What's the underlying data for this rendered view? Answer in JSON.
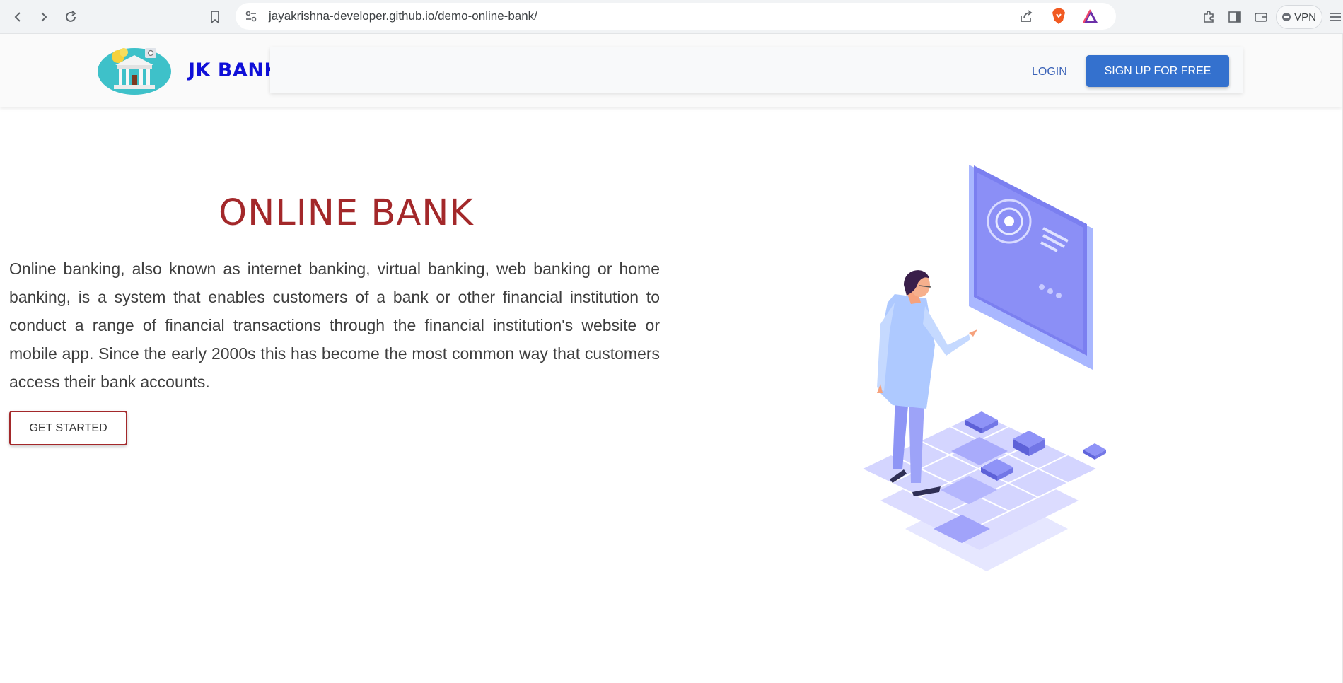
{
  "browser": {
    "url": "jayakrishna-developer.github.io/demo-online-bank/",
    "vpn_label": "VPN",
    "icons": [
      "back-icon",
      "forward-icon",
      "reload-icon",
      "bookmark-icon",
      "site-settings-icon",
      "share-icon",
      "brave-shield-icon",
      "brave-rewards-icon",
      "extensions-icon",
      "sidebar-icon",
      "wallet-icon",
      "menu-icon"
    ]
  },
  "header": {
    "brand": "JK BANK",
    "login_label": "LOGIN",
    "signup_label": "SIGN UP FOR FREE"
  },
  "hero": {
    "title": "ONLINE BANK",
    "description": "Online banking, also known as internet banking, virtual banking, web banking or home banking, is a system that enables customers of a bank or other financial institution to conduct a range of financial transactions through the financial institution's website or mobile app. Since the early 2000s this has become the most common way that customers access their bank accounts.",
    "cta_label": "GET STARTED"
  },
  "colors": {
    "brand": "#1010d8",
    "title": "#a3282a",
    "primary_button": "#3471ce",
    "illustration_accent": "#7b7ff0"
  }
}
